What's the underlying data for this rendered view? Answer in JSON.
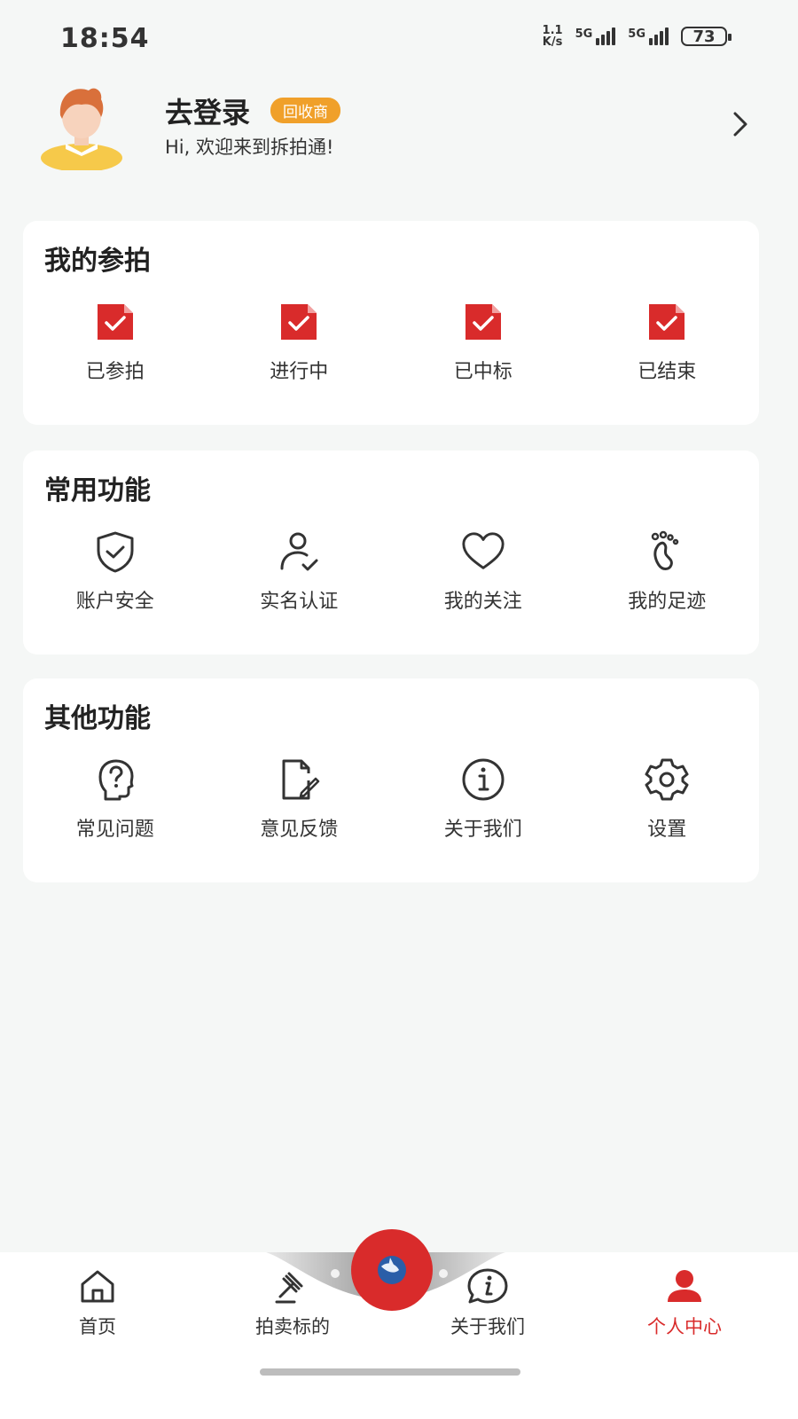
{
  "status_bar": {
    "time": "18:54",
    "net_speed_value": "1.1",
    "net_speed_unit": "K/s",
    "sim1_label": "5G",
    "sim2_label": "5G",
    "battery_level": "73"
  },
  "profile": {
    "name": "去登录",
    "role_badge": "回收商",
    "greeting": "Hi, 欢迎来到拆拍通!"
  },
  "my_auctions": {
    "title": "我的参拍",
    "items": [
      {
        "label": "已参拍",
        "icon": "doc-check-icon"
      },
      {
        "label": "进行中",
        "icon": "doc-check-icon"
      },
      {
        "label": "已中标",
        "icon": "doc-check-icon"
      },
      {
        "label": "已结束",
        "icon": "doc-check-icon"
      }
    ]
  },
  "common_functions": {
    "title": "常用功能",
    "items": [
      {
        "label": "账户安全",
        "icon": "shield-check-icon"
      },
      {
        "label": "实名认证",
        "icon": "user-check-icon"
      },
      {
        "label": "我的关注",
        "icon": "heart-icon"
      },
      {
        "label": "我的足迹",
        "icon": "footprint-icon"
      }
    ]
  },
  "other_functions": {
    "title": "其他功能",
    "items": [
      {
        "label": "常见问题",
        "icon": "question-head-icon"
      },
      {
        "label": "意见反馈",
        "icon": "feedback-doc-icon"
      },
      {
        "label": "关于我们",
        "icon": "info-circle-icon"
      },
      {
        "label": "设置",
        "icon": "gear-icon"
      }
    ]
  },
  "bottom_nav": {
    "items": [
      {
        "label": "首页",
        "icon": "home-icon"
      },
      {
        "label": "拍卖标的",
        "icon": "gavel-icon"
      },
      {
        "label": "关于我们",
        "icon": "info-chat-icon"
      },
      {
        "label": "个人中心",
        "icon": "person-icon",
        "active": true
      }
    ]
  },
  "colors": {
    "accent_red": "#d92b2b",
    "badge_orange": "#f0a02a",
    "background": "#f5f7f6"
  }
}
